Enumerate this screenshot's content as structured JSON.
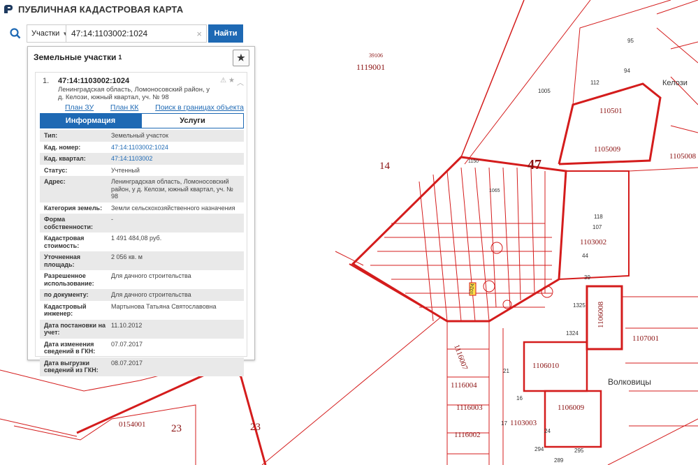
{
  "app": {
    "title": "ПУБЛИЧНАЯ КАДАСТРОВАЯ КАРТА"
  },
  "search": {
    "type_label": "Участки",
    "query": "47:14:1103002:1024",
    "find_label": "Найти"
  },
  "panel": {
    "title": "Земельные участки",
    "count": "1",
    "result": {
      "index": "1.",
      "number": "47:14:1103002:1024",
      "address_short": "Ленинградская область, Ломоносовский район, у д. Келози, южный квартал, уч. № 98",
      "links": [
        "План ЗУ →",
        "План КК →",
        "Поиск в границах объекта →"
      ],
      "tabs": [
        "Информация",
        "Услуги"
      ],
      "props": [
        {
          "k": "Тип:",
          "v": "Земельный участок"
        },
        {
          "k": "Кад. номер:",
          "v": "47:14:1103002:1024"
        },
        {
          "k": "Кад. квартал:",
          "v": "47:14:1103002"
        },
        {
          "k": "Статус:",
          "v": "Учтенный"
        },
        {
          "k": "Адрес:",
          "v": "Ленинградская область, Ломоносовский район, у д. Келози, южный квартал, уч. № 98"
        },
        {
          "k": "Категория земель:",
          "v": "Земли сельскохозяйственного назначения"
        },
        {
          "k": "Форма собственности:",
          "v": "-"
        },
        {
          "k": "Кадастровая стоимость:",
          "v": "1 491 484,08 руб."
        },
        {
          "k": "Уточненная площадь:",
          "v": "2 056 кв. м"
        },
        {
          "k": "Разрешенное использование:",
          "v": "Для дачного строительства"
        },
        {
          "k": "по документу:",
          "v": "Для дачного строительства"
        },
        {
          "k": "Кадастровый инженер:",
          "v": "Мартынова Татьяна Святославовна"
        },
        {
          "k": "Дата постановки на учет:",
          "v": "11.10.2012"
        },
        {
          "k": "Дата изменения сведений в ГКН:",
          "v": "07.07.2017"
        },
        {
          "k": "Дата выгрузки сведений из ГКН:",
          "v": "08.07.2017"
        }
      ]
    }
  },
  "map": {
    "labels_big": [
      "47",
      "14",
      "23",
      "23"
    ],
    "quarters": [
      "1119001",
      "1105009",
      "1105008",
      "1103002",
      "1106008",
      "1107001",
      "1106010",
      "1106009",
      "1116007",
      "1116004",
      "1116003",
      "1116002",
      "1103003",
      "0154001",
      "110501"
    ],
    "small": [
      "39106",
      "1005",
      "112",
      "94",
      "95",
      "107",
      "118",
      "44",
      "39",
      "1325",
      "1324",
      "21",
      "16",
      "17",
      "24",
      "294",
      "289",
      "295",
      "1150",
      "1065",
      "1024"
    ],
    "places": [
      "Келози",
      "Волковицы"
    ],
    "colors": {
      "boundary": "#d41c1c",
      "label": "#8a1010",
      "highlight": "#ffe14a"
    }
  }
}
